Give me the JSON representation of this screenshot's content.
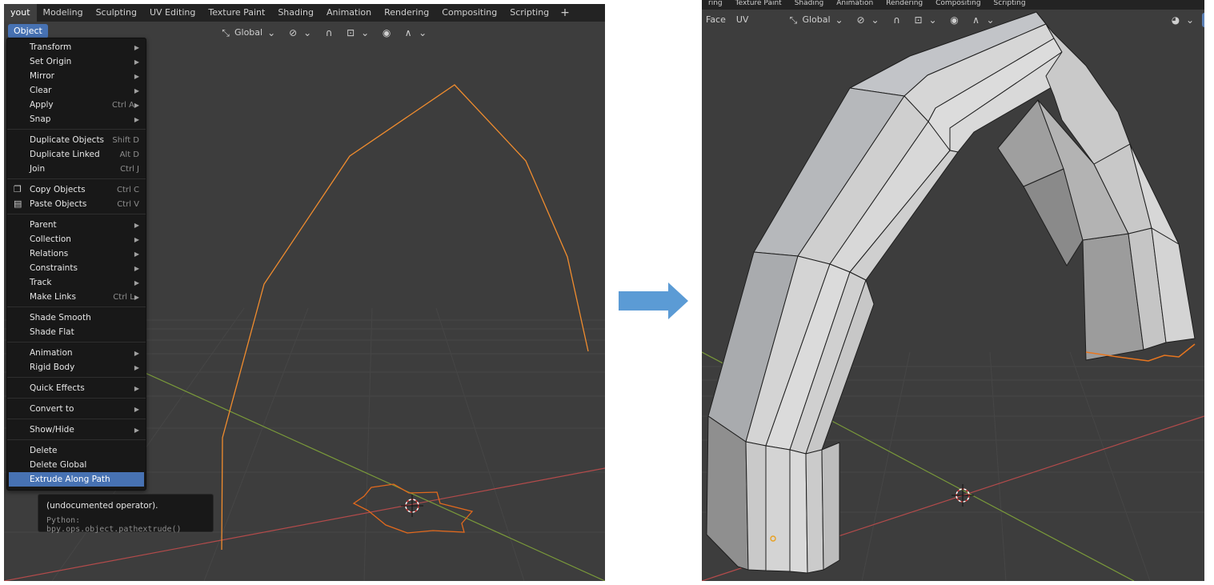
{
  "left": {
    "workspace_tabs": [
      "yout",
      "Modeling",
      "Sculpting",
      "UV Editing",
      "Texture Paint",
      "Shading",
      "Animation",
      "Rendering",
      "Compositing",
      "Scripting"
    ],
    "header": {
      "object_menu": "Object",
      "orientation": "Global"
    },
    "menu": {
      "groups": [
        [
          {
            "label": "Transform",
            "shortcut": "",
            "submenu": true,
            "icon": ""
          },
          {
            "label": "Set Origin",
            "shortcut": "",
            "submenu": true,
            "icon": ""
          },
          {
            "label": "Mirror",
            "shortcut": "",
            "submenu": true,
            "icon": ""
          },
          {
            "label": "Clear",
            "shortcut": "",
            "submenu": true,
            "icon": ""
          },
          {
            "label": "Apply",
            "shortcut": "Ctrl A",
            "submenu": true,
            "icon": ""
          },
          {
            "label": "Snap",
            "shortcut": "",
            "submenu": true,
            "icon": ""
          }
        ],
        [
          {
            "label": "Duplicate Objects",
            "shortcut": "Shift D",
            "submenu": false,
            "icon": ""
          },
          {
            "label": "Duplicate Linked",
            "shortcut": "Alt D",
            "submenu": false,
            "icon": ""
          },
          {
            "label": "Join",
            "shortcut": "Ctrl J",
            "submenu": false,
            "icon": ""
          }
        ],
        [
          {
            "label": "Copy Objects",
            "shortcut": "Ctrl C",
            "submenu": false,
            "icon": "copy-icon"
          },
          {
            "label": "Paste Objects",
            "shortcut": "Ctrl V",
            "submenu": false,
            "icon": "paste-icon"
          }
        ],
        [
          {
            "label": "Parent",
            "shortcut": "",
            "submenu": true,
            "icon": ""
          },
          {
            "label": "Collection",
            "shortcut": "",
            "submenu": true,
            "icon": ""
          },
          {
            "label": "Relations",
            "shortcut": "",
            "submenu": true,
            "icon": ""
          },
          {
            "label": "Constraints",
            "shortcut": "",
            "submenu": true,
            "icon": ""
          },
          {
            "label": "Track",
            "shortcut": "",
            "submenu": true,
            "icon": ""
          },
          {
            "label": "Make Links",
            "shortcut": "Ctrl L",
            "submenu": true,
            "icon": ""
          }
        ],
        [
          {
            "label": "Shade Smooth",
            "shortcut": "",
            "submenu": false,
            "icon": ""
          },
          {
            "label": "Shade Flat",
            "shortcut": "",
            "submenu": false,
            "icon": ""
          }
        ],
        [
          {
            "label": "Animation",
            "shortcut": "",
            "submenu": true,
            "icon": ""
          },
          {
            "label": "Rigid Body",
            "shortcut": "",
            "submenu": true,
            "icon": ""
          }
        ],
        [
          {
            "label": "Quick Effects",
            "shortcut": "",
            "submenu": true,
            "icon": ""
          }
        ],
        [
          {
            "label": "Convert to",
            "shortcut": "",
            "submenu": true,
            "icon": ""
          }
        ],
        [
          {
            "label": "Show/Hide",
            "shortcut": "",
            "submenu": true,
            "icon": ""
          }
        ],
        [
          {
            "label": "Delete",
            "shortcut": "",
            "submenu": false,
            "icon": ""
          },
          {
            "label": "Delete Global",
            "shortcut": "",
            "submenu": false,
            "icon": ""
          },
          {
            "label": "Extrude Along Path",
            "shortcut": "",
            "submenu": false,
            "icon": "",
            "highlighted": true
          }
        ]
      ]
    },
    "tooltip": {
      "description": "(undocumented operator).",
      "python": "Python: bpy.ops.object.pathextrude()"
    }
  },
  "right": {
    "workspace_tabs": [
      "ring",
      "Texture Paint",
      "Shading",
      "Animation",
      "Rendering",
      "Compositing",
      "Scripting"
    ],
    "header": {
      "face_menu": "Face",
      "uv_menu": "UV",
      "orientation": "Global"
    }
  },
  "icons": {
    "orientation": "transform-orientation-icon",
    "pivot": "pivot-point-icon",
    "snap": "snap-magnet-icon",
    "snap_target": "snap-target-icon",
    "proportional": "proportional-editing-icon",
    "falloff": "falloff-curve-icon",
    "cursor": "3d-cursor-icon",
    "visibility": "visibility-eye-icon",
    "arrow": "right-arrow-icon"
  },
  "colors": {
    "viewport_bg": "#3d3d3d",
    "menu_bg": "#181818",
    "highlight": "#4772b3",
    "selection_orange": "#f08c2e",
    "axis_x_red": "#b34b4b",
    "axis_y_green": "#7a9a3a",
    "arrow_blue": "#5b9bd5",
    "mesh_face": "#c9c9c9"
  }
}
